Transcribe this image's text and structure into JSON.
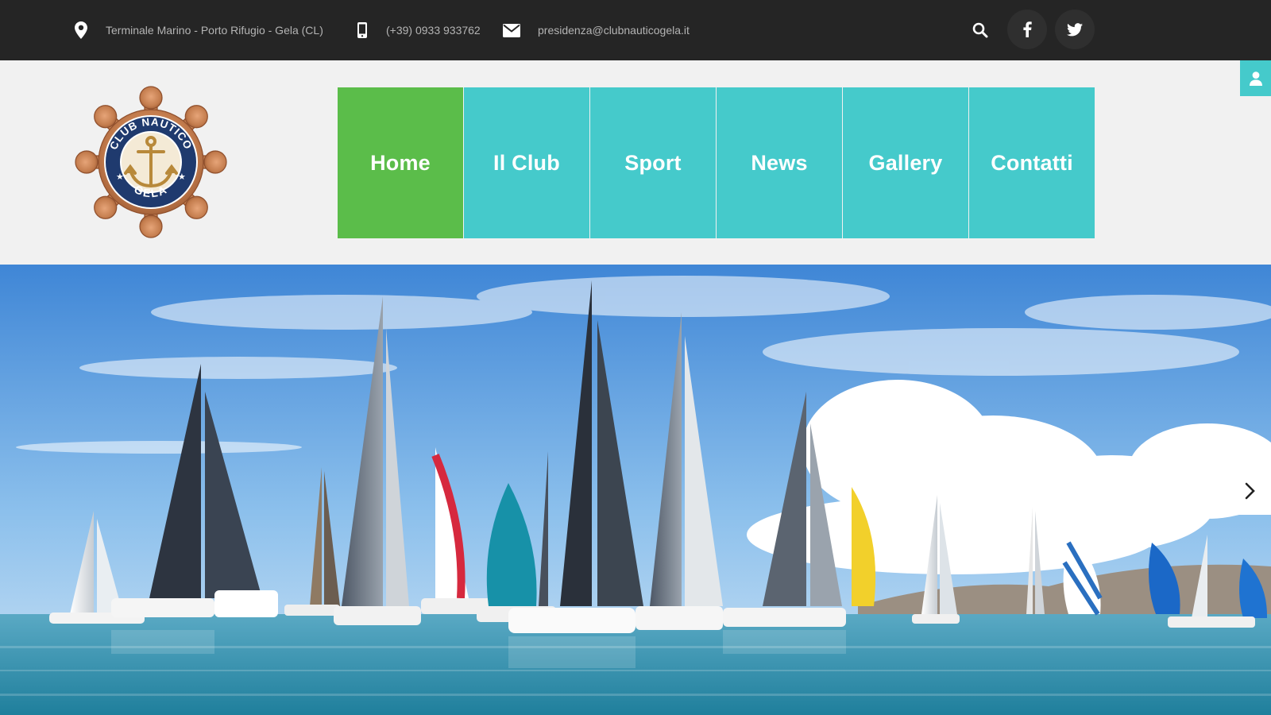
{
  "topbar": {
    "address": "Terminale Marino - Porto Rifugio - Gela (CL)",
    "phone": "(+39) 0933 933762",
    "email": "presidenza@clubnauticogela.it",
    "icons": [
      "map-pin-icon",
      "mobile-phone-icon",
      "envelope-icon",
      "search-icon",
      "facebook-icon",
      "twitter-icon"
    ]
  },
  "logo": {
    "top_text": "CLUB NAUTICO",
    "bottom_text": "GELA",
    "colors": {
      "bronze": "#c47d4e",
      "navy": "#1f3a6e",
      "gold": "#b8893a"
    }
  },
  "nav": {
    "items": [
      {
        "label": "Home",
        "active": true
      },
      {
        "label": "Il Club",
        "active": false
      },
      {
        "label": "Sport",
        "active": false
      },
      {
        "label": "News",
        "active": false
      },
      {
        "label": "Gallery",
        "active": false
      },
      {
        "label": "Contatti",
        "active": false
      }
    ]
  },
  "user_tab": {
    "icon": "user-icon"
  },
  "hero": {
    "icon_next": "chevron-right-icon"
  },
  "colors": {
    "topbar_bg": "#252525",
    "nav_teal": "#45cacb",
    "nav_active_green": "#5bbd4a",
    "header_bg": "#f1f1f1"
  }
}
